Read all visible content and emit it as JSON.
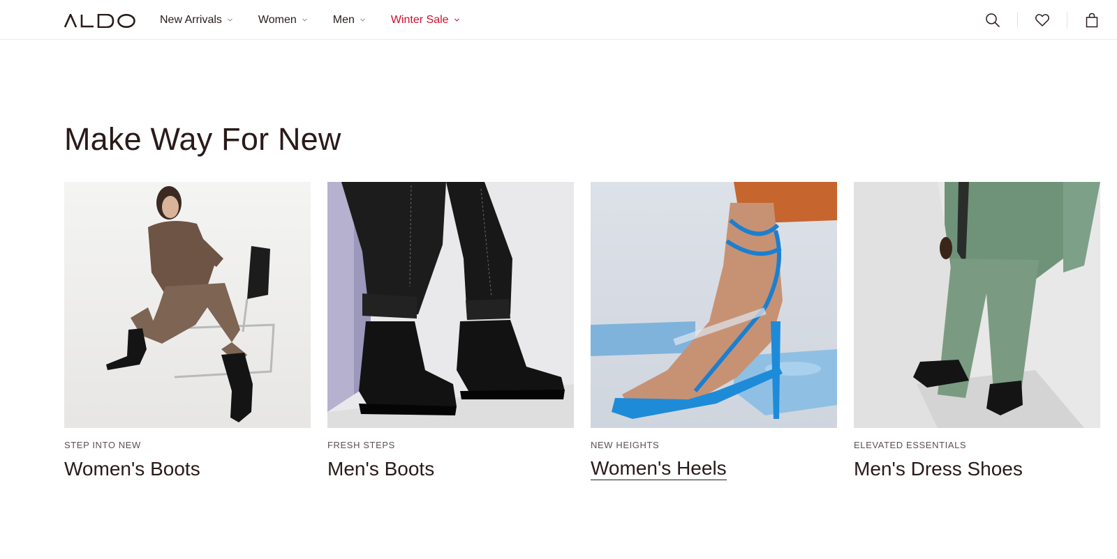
{
  "brand": {
    "logo_text": "ALDO"
  },
  "nav": {
    "items": [
      {
        "label": "New Arrivals",
        "sale": false
      },
      {
        "label": "Women",
        "sale": false
      },
      {
        "label": "Men",
        "sale": false
      },
      {
        "label": "Winter Sale",
        "sale": true
      }
    ]
  },
  "header_icons": [
    "search-icon",
    "heart-icon",
    "shopping-bag-icon"
  ],
  "section": {
    "title": "Make Way For New",
    "cards": [
      {
        "eyebrow": "STEP INTO NEW",
        "title": "Women's Boots",
        "hovered": false
      },
      {
        "eyebrow": "FRESH STEPS",
        "title": "Men's Boots",
        "hovered": false
      },
      {
        "eyebrow": "NEW HEIGHTS",
        "title": "Women's Heels",
        "hovered": true
      },
      {
        "eyebrow": "ELEVATED ESSENTIALS",
        "title": "Men's Dress Shoes",
        "hovered": false
      }
    ]
  },
  "colors": {
    "text": "#2a1a1a",
    "sale": "#c8102e",
    "eyebrow": "#5b5151",
    "divider": "#ececec"
  }
}
